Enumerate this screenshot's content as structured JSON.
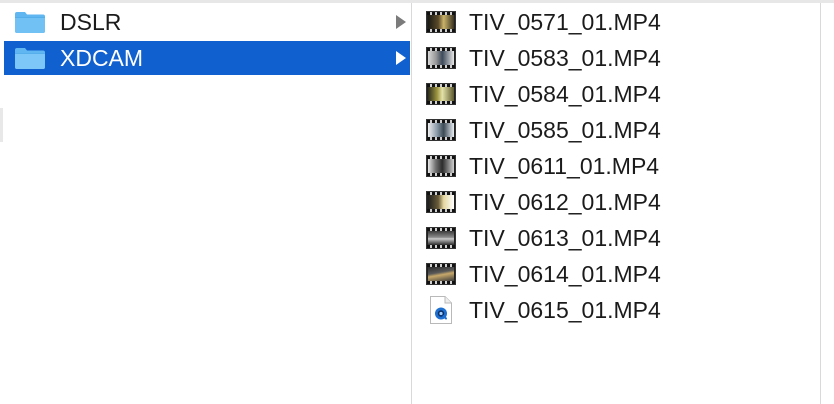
{
  "folders": [
    {
      "name": "DSLR",
      "icon": "folder-icon",
      "selected": false
    },
    {
      "name": "XDCAM",
      "icon": "folder-icon",
      "selected": true
    }
  ],
  "files": [
    {
      "name": "TIV_0571_01.MP4",
      "icon": "video-thumbnail-icon"
    },
    {
      "name": "TIV_0583_01.MP4",
      "icon": "video-thumbnail-icon"
    },
    {
      "name": "TIV_0584_01.MP4",
      "icon": "video-thumbnail-icon"
    },
    {
      "name": "TIV_0585_01.MP4",
      "icon": "video-thumbnail-icon"
    },
    {
      "name": "TIV_0611_01.MP4",
      "icon": "video-thumbnail-icon"
    },
    {
      "name": "TIV_0612_01.MP4",
      "icon": "video-thumbnail-icon"
    },
    {
      "name": "TIV_0613_01.MP4",
      "icon": "video-thumbnail-icon"
    },
    {
      "name": "TIV_0614_01.MP4",
      "icon": "video-thumbnail-icon"
    },
    {
      "name": "TIV_0615_01.MP4",
      "icon": "quicktime-document-icon"
    }
  ],
  "colors": {
    "selection": "#1160d0",
    "folder": "#5fb6f1",
    "disclosure": "#7b7b7b"
  }
}
